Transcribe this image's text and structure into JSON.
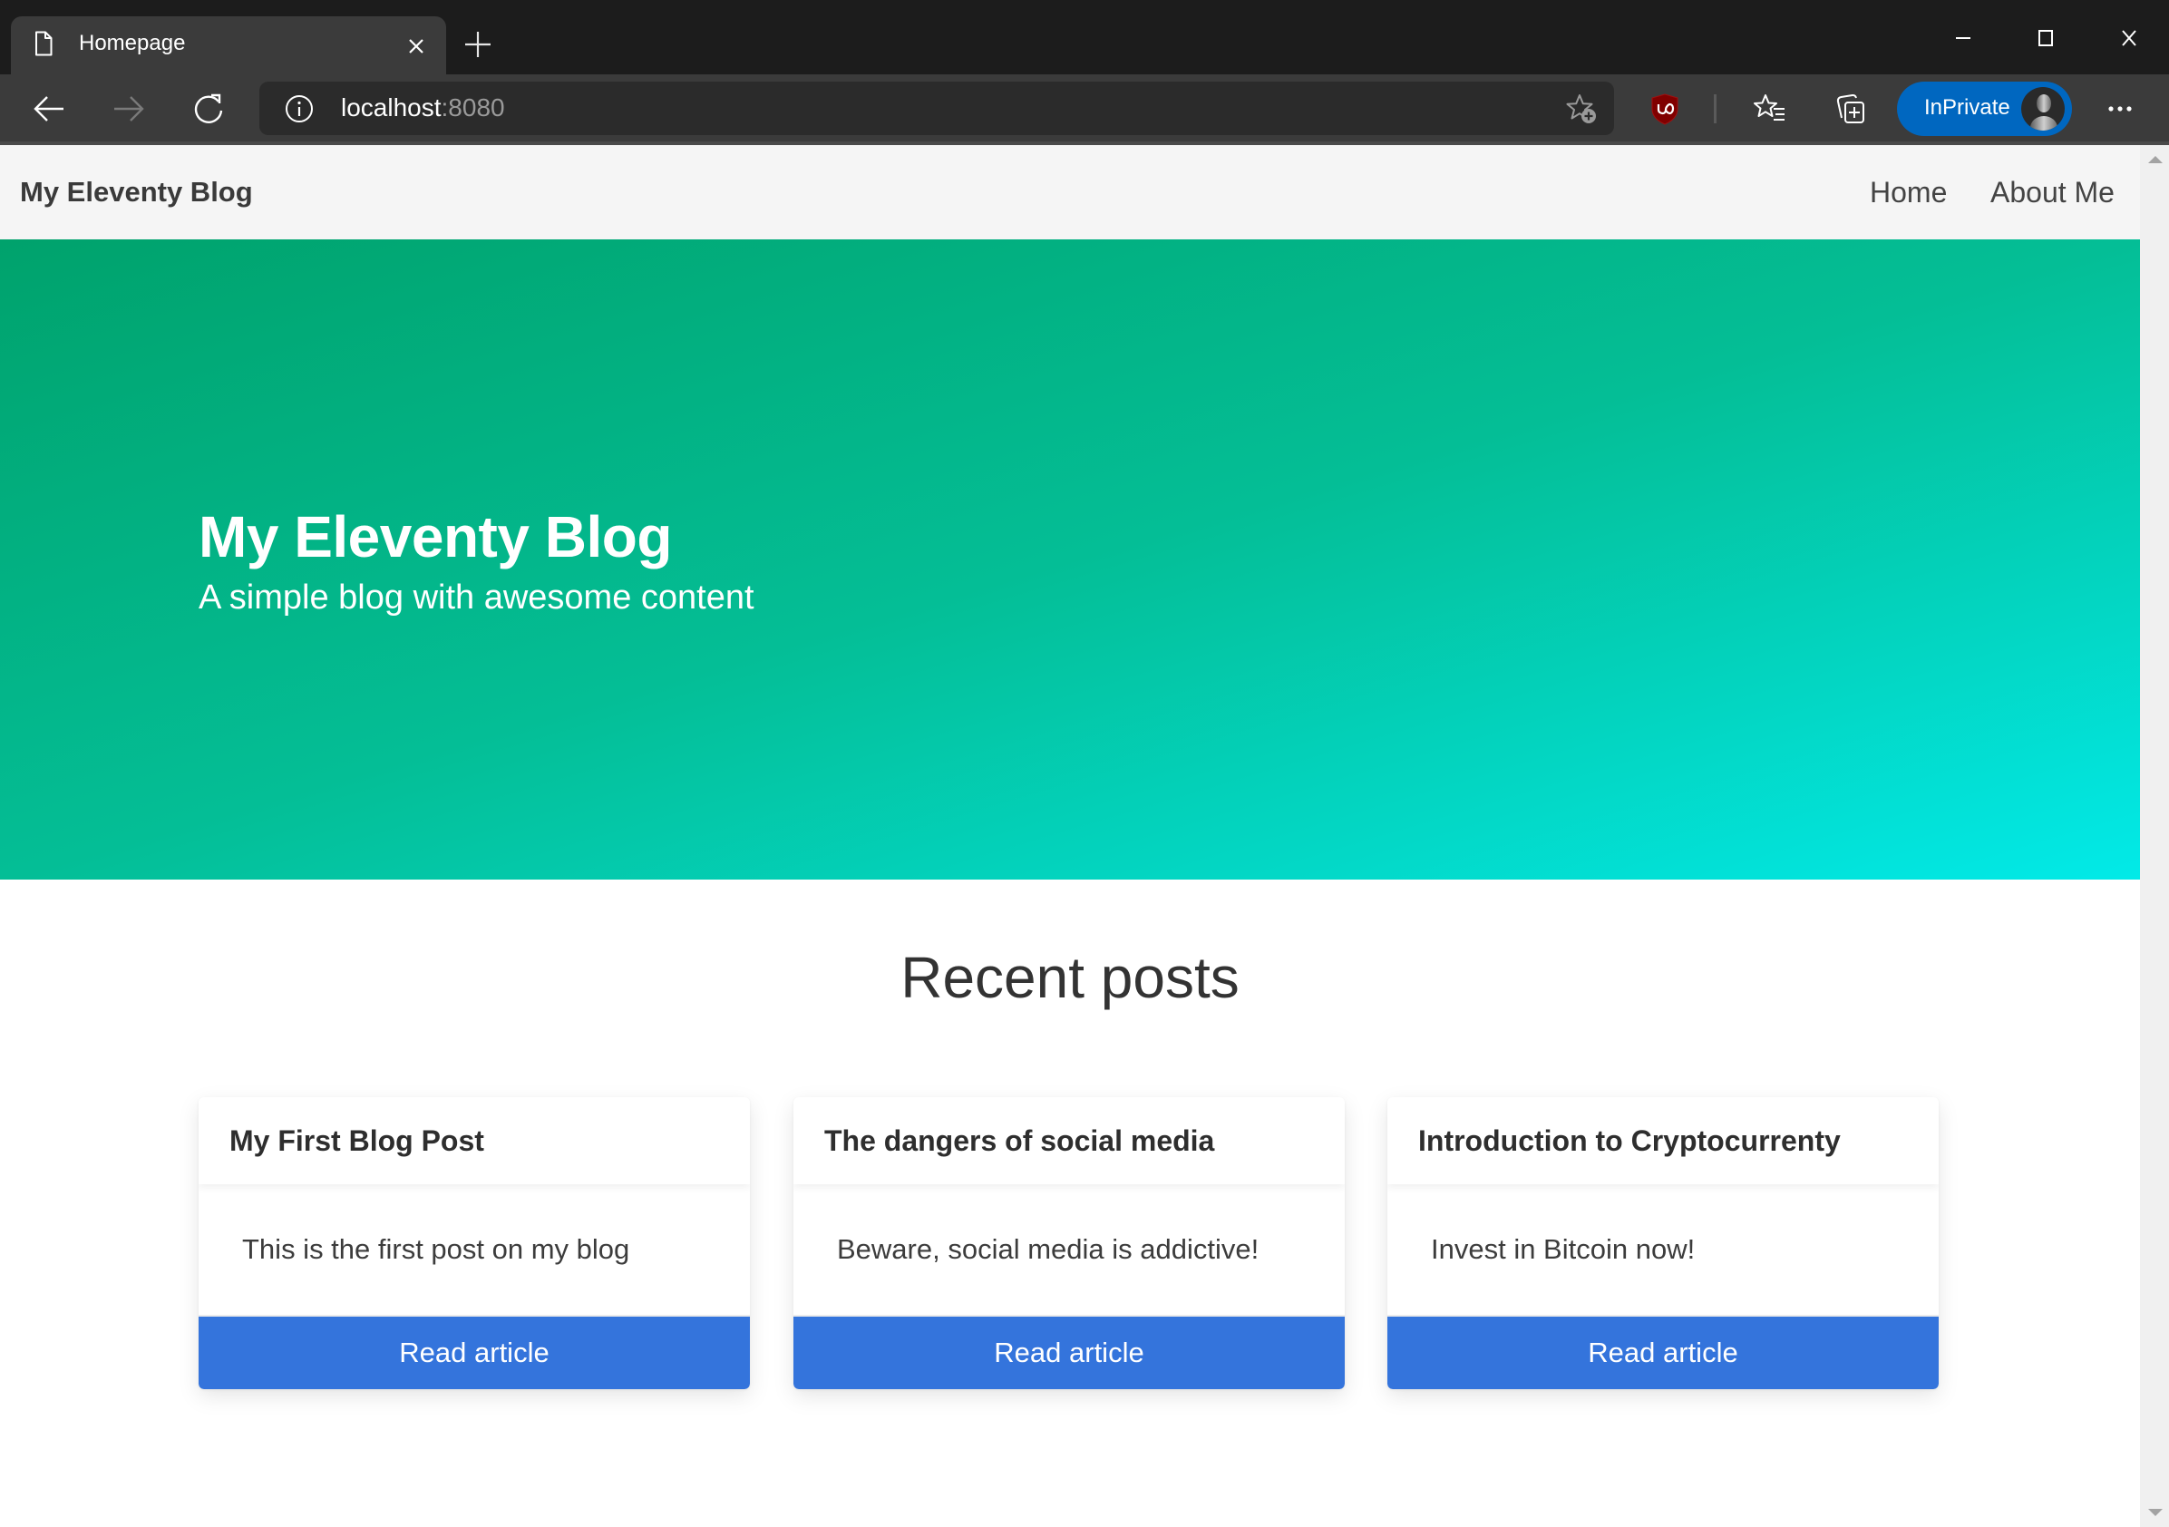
{
  "browser": {
    "tab": {
      "title": "Homepage",
      "icon": "page-icon"
    },
    "window_controls": {
      "minimize": "minimize-icon",
      "maximize": "maximize-icon",
      "close": "close-icon"
    },
    "address": {
      "host": "localhost",
      "port": ":8080"
    },
    "toolbar": {
      "inprivate_label": "InPrivate",
      "extension": "ublock-origin-icon"
    }
  },
  "site": {
    "brand": "My Eleventy Blog",
    "nav": [
      {
        "label": "Home"
      },
      {
        "label": "About Me"
      }
    ],
    "hero": {
      "title": "My Eleventy Blog",
      "subtitle": "A simple blog with awesome content"
    },
    "recent": {
      "heading": "Recent posts",
      "posts": [
        {
          "title": "My First Blog Post",
          "excerpt": "This is the first post on my blog",
          "button": "Read article"
        },
        {
          "title": "The dangers of social media",
          "excerpt": "Beware, social media is addictive!",
          "button": "Read article"
        },
        {
          "title": "Introduction to Cryptocurrenty",
          "excerpt": "Invest in Bitcoin now!",
          "button": "Read article"
        }
      ]
    }
  },
  "colors": {
    "hero_gradient_start": "#00a26c",
    "hero_gradient_end": "#02eae8",
    "button": "#3474dc",
    "inprivate": "#0067c0"
  }
}
